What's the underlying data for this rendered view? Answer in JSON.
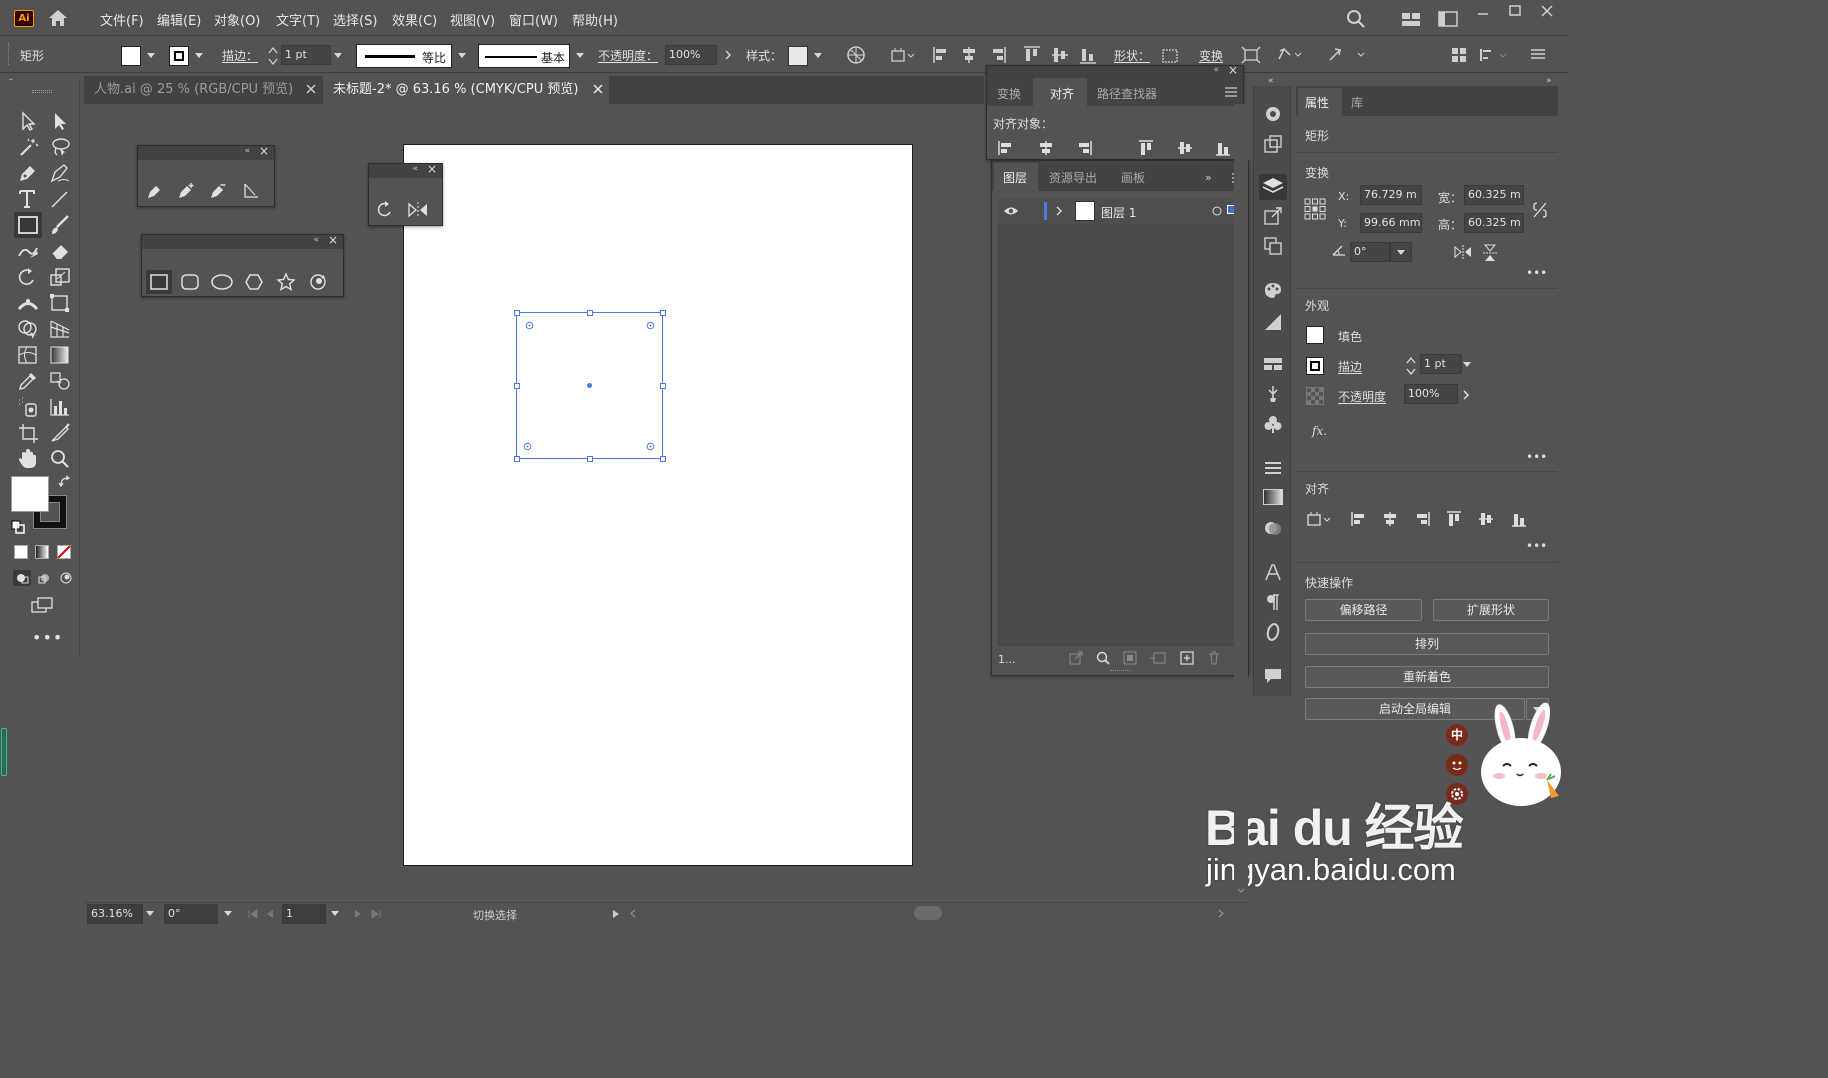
{
  "app": {
    "logo": "Ai"
  },
  "menu": [
    "文件(F)",
    "编辑(E)",
    "对象(O)",
    "文字(T)",
    "选择(S)",
    "效果(C)",
    "视图(V)",
    "窗口(W)",
    "帮助(H)"
  ],
  "control": {
    "object_type": "矩形",
    "stroke_label": "描边：",
    "stroke_value": "1 pt",
    "profile_label": "等比",
    "brush_label": "基本",
    "opacity_label": "不透明度：",
    "opacity_value": "100%",
    "style_label": "样式：",
    "shape_label": "形状：",
    "transform_label": "变换"
  },
  "tabs": [
    {
      "label": "人物.ai @ 25 % (RGB/CPU 预览)",
      "active": false
    },
    {
      "label": "未标题-2* @ 63.16 % (CMYK/CPU 预览)",
      "active": true
    }
  ],
  "align_panel": {
    "tabs": [
      "变换",
      "对齐",
      "路径查找器"
    ],
    "align_to_label": "对齐对象："
  },
  "layers_panel": {
    "tabs": [
      "图层",
      "资源导出",
      "画板"
    ],
    "layer_name": "图层 1",
    "count": "1..."
  },
  "properties": {
    "tabs": [
      "属性",
      "库"
    ],
    "object_type": "矩形",
    "transform_title": "变换",
    "x_label": "X:",
    "x_value": "76.729 m",
    "y_label": "Y:",
    "y_value": "99.66 mm",
    "w_label": "宽：",
    "w_value": "60.325 m",
    "h_label": "高：",
    "h_value": "60.325 m",
    "angle_value": "0°",
    "appearance_title": "外观",
    "fill_label": "填色",
    "stroke_label": "描边",
    "stroke_value": "1 pt",
    "opacity_label": "不透明度",
    "opacity_value": "100%",
    "fx_label": "fx.",
    "align_title": "对齐",
    "quick_title": "快速操作",
    "btn_offset": "偏移路径",
    "btn_expand": "扩展形状",
    "btn_arrange": "排列",
    "btn_recolor": "重新着色",
    "btn_global": "启动全局编辑"
  },
  "status": {
    "zoom": "63.16%",
    "rotate": "0°",
    "artboard_num": "1",
    "mode": "切换选择"
  },
  "watermark": {
    "brand": "Bai du 经验",
    "url": "jingyan.baidu.com",
    "ime": "中"
  },
  "colors": {
    "accent": "#3f6fd9",
    "chrome": "#535353",
    "dark": "#424242",
    "logo_bg": "#330000",
    "logo_fg": "#ff9a00"
  }
}
